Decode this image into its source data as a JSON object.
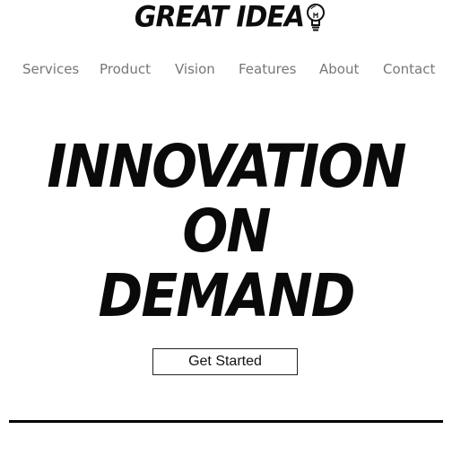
{
  "logo": {
    "text": "GREAT IDEA",
    "icon": "lightbulb-icon"
  },
  "nav": {
    "items": [
      {
        "label": "Services"
      },
      {
        "label": "Product"
      },
      {
        "label": "Vision"
      },
      {
        "label": "Features"
      },
      {
        "label": "About"
      },
      {
        "label": "Contact"
      }
    ]
  },
  "hero": {
    "lines": [
      "INNOVATION",
      "ON",
      "DEMAND"
    ]
  },
  "cta": {
    "label": "Get Started"
  },
  "colors": {
    "text": "#0a0a0a",
    "nav": "#777777",
    "background": "#ffffff"
  }
}
